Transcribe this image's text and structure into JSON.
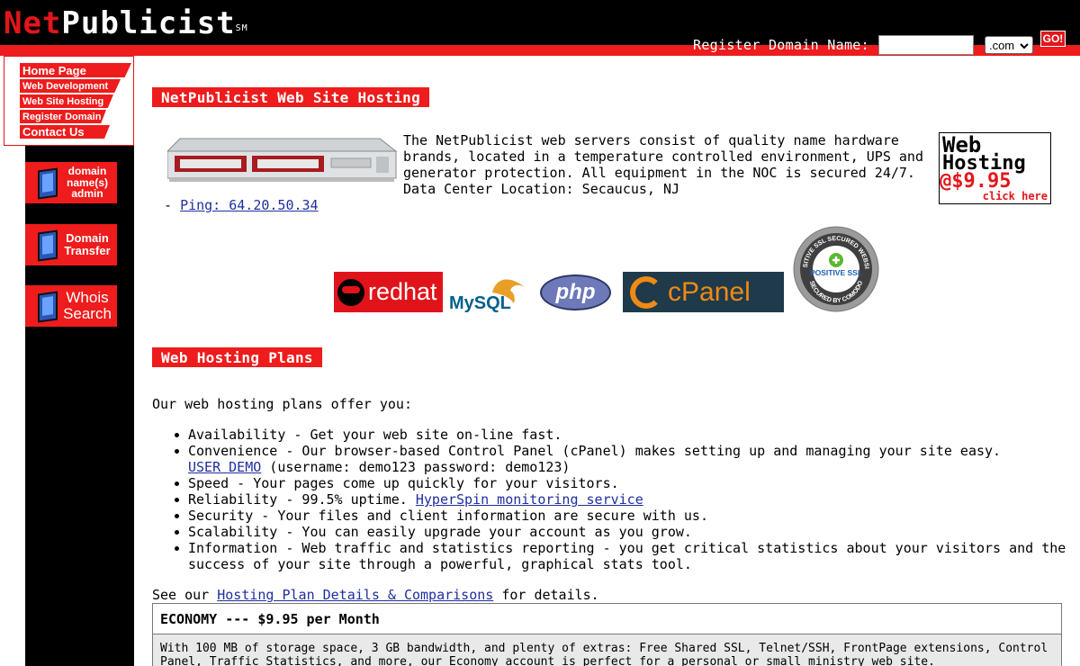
{
  "header": {
    "logo_net": "Net",
    "logo_publicist": "Publicist",
    "logo_sm": "SM",
    "register_label": "Register Domain Name:",
    "domain_value": "",
    "tld_selected": ".com",
    "go_label": "GO!"
  },
  "nav": {
    "items": [
      {
        "label": "Home Page"
      },
      {
        "label": "Web Development"
      },
      {
        "label": "Web Site Hosting"
      },
      {
        "label": "Register Domain"
      },
      {
        "label": "Contact Us"
      }
    ]
  },
  "side_buttons": [
    {
      "label": "domain name(s) admin"
    },
    {
      "label": "Domain Transfer"
    },
    {
      "label": "Whois Search"
    }
  ],
  "main": {
    "hosting_title": "NetPublicist Web Site Hosting",
    "intro_text": "The NetPublicist web servers consist of quality name hardware brands, located in a temperature controlled environment, UPS and generator protection. All equipment in the NOC is secured 24/7. Data Center Location: Secaucus, NJ",
    "ping_prefix": " - ",
    "ping_link": "Ping: 64.20.50.34",
    "promo": {
      "line1": "Web",
      "line2": "Hosting",
      "line3": "@$9.95",
      "line4": "click here"
    },
    "logos": {
      "redhat": "redhat",
      "mysql": "MySQL",
      "php": "php",
      "cpanel": "cPanel",
      "ssl_top": "POSITIVE SSL SECURED WEBSITE",
      "ssl_mid": "POSITIVE SSL",
      "ssl_bottom": "SECURED BY COMODO"
    },
    "plans_title": "Web Hosting Plans",
    "plans_intro": "Our web hosting plans offer you:",
    "bullets": {
      "availability": "Availability - Get your web site on-line fast.",
      "convenience": "Convenience - Our browser-based Control Panel (cPanel) makes setting up and managing your site easy.",
      "user_demo_link": "USER DEMO",
      "user_demo_text": " (username: demo123 password: demo123)",
      "speed": "Speed - Your pages come up quickly for your visitors.",
      "reliability": "Reliability - 99.5% uptime. ",
      "hyperspin_link": "HyperSpin monitoring service",
      "security": "Security - Your files and client information are secure with us.",
      "scalability": "Scalability - You can easily upgrade your account as you grow.",
      "information": "Information - Web traffic and statistics reporting - you get critical statistics about your visitors and the success of your site through a powerful, graphical stats tool."
    },
    "see_prefix": "See our ",
    "see_link": "Hosting Plan Details & Comparisons",
    "see_suffix": " for details.",
    "economy_title": "ECONOMY --- $9.95 per Month",
    "economy_text": "With 100 MB of storage space, 3 GB bandwidth, and plenty of extras: Free Shared SSL, Telnet/SSH, FrontPage extensions, Control Panel, Traffic Statistics, and more, our Economy account is perfect for a personal or small ministry web site."
  },
  "colors": {
    "brand_red": "#ee1c1c",
    "link_blue": "#1f2ea0"
  }
}
